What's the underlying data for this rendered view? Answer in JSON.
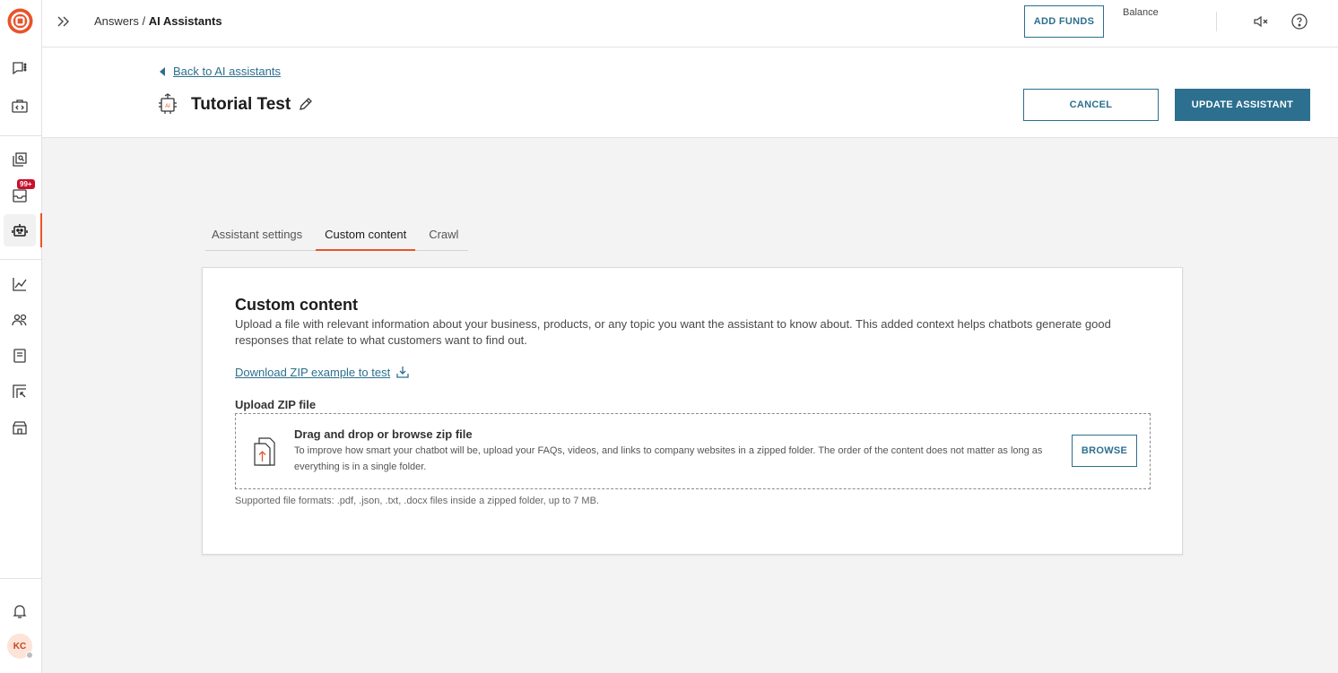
{
  "topbar": {
    "breadcrumb_parent": "Answers",
    "breadcrumb_separator": " / ",
    "breadcrumb_current": "AI Assistants",
    "add_funds_label": "ADD FUNDS",
    "balance_label": "Balance"
  },
  "sidebar": {
    "notification_badge": "99+",
    "avatar_initials": "KC",
    "active_item": "ai-assistants"
  },
  "header": {
    "back_label": "Back to AI assistants",
    "assistant_icon_label": "AI",
    "title": "Tutorial Test",
    "cancel_label": "CANCEL",
    "update_label": "UPDATE ASSISTANT"
  },
  "tabs": [
    {
      "label": "Assistant settings",
      "active": false
    },
    {
      "label": "Custom content",
      "active": true
    },
    {
      "label": "Crawl",
      "active": false
    }
  ],
  "content": {
    "heading": "Custom content",
    "description": "Upload a file with relevant information about your business, products, or any topic you want the assistant to know about. This added context helps chatbots generate good responses that relate to what customers want to find out.",
    "download_link": "Download ZIP example to test",
    "upload_label": "Upload ZIP file",
    "dropzone_title": "Drag and drop or browse zip file",
    "dropzone_text": "To improve how smart your chatbot will be, upload your FAQs, videos, and links to company websites in a zipped folder. The order of the content does not matter as long as everything is in a single folder.",
    "browse_label": "BROWSE",
    "formats_text": "Supported file formats: .pdf, .json, .txt, .docx files inside a zipped folder, up to 7 MB."
  },
  "colors": {
    "accent": "#2c6f8e",
    "brand": "#e8542a",
    "badge": "#c8102e"
  }
}
